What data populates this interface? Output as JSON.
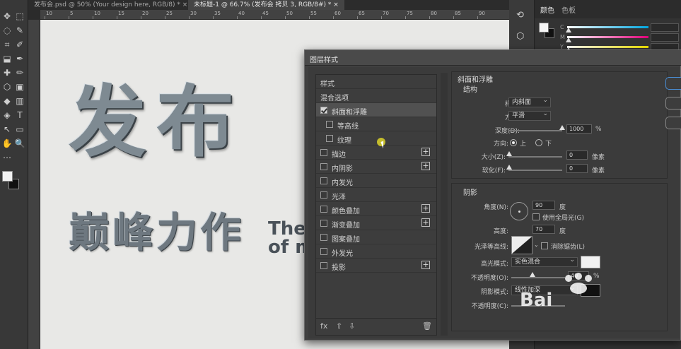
{
  "tabs": [
    {
      "label": "发布会.psd @ 50% (Your design here, RGB/8) *",
      "close": "×",
      "active": false
    },
    {
      "label": "未标题-1 @ 66.7% (发布会 拷贝 3, RGB/8#) *",
      "close": "×",
      "active": true
    }
  ],
  "ruler": {
    "top_ticks": [
      "10",
      "5",
      "10",
      "15",
      "20",
      "25",
      "30",
      "35",
      "40",
      "45",
      "50",
      "55",
      "60",
      "65",
      "70",
      "75",
      "80",
      "85",
      "90",
      "95"
    ]
  },
  "toolbar": {
    "tools": [
      {
        "a": "✥",
        "b": "⬚"
      },
      {
        "a": "◌",
        "b": "✎"
      },
      {
        "a": "⌗",
        "b": "✐"
      },
      {
        "a": "⬓",
        "b": "✒"
      },
      {
        "a": "✚",
        "b": "✏"
      },
      {
        "a": "⬡",
        "b": "▣"
      },
      {
        "a": "◆",
        "b": "▥"
      },
      {
        "a": "◈",
        "b": "T"
      },
      {
        "a": "↖",
        "b": "▭"
      },
      {
        "a": "✋",
        "b": "🔍"
      },
      {
        "a": "⋯",
        "b": ""
      }
    ]
  },
  "canvas": {
    "headline": "发布",
    "subline": "巅峰力作",
    "english_1": "The",
    "english_2": "of m"
  },
  "right_panel": {
    "tabs": [
      {
        "label": "颜色",
        "active": true
      },
      {
        "label": "色板",
        "active": false
      }
    ],
    "channels": [
      {
        "label": "C",
        "color": "#00a6e0",
        "value": ""
      },
      {
        "label": "M",
        "color": "#e0007a",
        "value": ""
      },
      {
        "label": "Y",
        "color": "#f2e600",
        "value": ""
      }
    ],
    "pct": "%"
  },
  "dialog": {
    "title": "图层样式",
    "styles_header": "样式",
    "blend_options": "混合选项",
    "items": [
      {
        "label": "斜面和浮雕",
        "checked": true,
        "plus": false,
        "indent": false,
        "selected": true
      },
      {
        "label": "等高线",
        "checked": false,
        "plus": false,
        "indent": true,
        "selected": false
      },
      {
        "label": "纹理",
        "checked": false,
        "plus": false,
        "indent": true,
        "selected": false
      },
      {
        "label": "描边",
        "checked": false,
        "plus": true,
        "indent": false,
        "selected": false
      },
      {
        "label": "内阴影",
        "checked": false,
        "plus": true,
        "indent": false,
        "selected": false
      },
      {
        "label": "内发光",
        "checked": false,
        "plus": false,
        "indent": false,
        "selected": false
      },
      {
        "label": "光泽",
        "checked": false,
        "plus": false,
        "indent": false,
        "selected": false
      },
      {
        "label": "颜色叠加",
        "checked": false,
        "plus": true,
        "indent": false,
        "selected": false
      },
      {
        "label": "渐变叠加",
        "checked": false,
        "plus": true,
        "indent": false,
        "selected": false
      },
      {
        "label": "图案叠加",
        "checked": false,
        "plus": false,
        "indent": false,
        "selected": false
      },
      {
        "label": "外发光",
        "checked": false,
        "plus": false,
        "indent": false,
        "selected": false
      },
      {
        "label": "投影",
        "checked": false,
        "plus": true,
        "indent": false,
        "selected": false
      }
    ],
    "footer": {
      "fx": "fx",
      "up": "⇧",
      "down": "⇩",
      "trash": "🗑"
    },
    "bevel": {
      "title": "斜面和浮雕",
      "structure_title": "结构",
      "style_label": "样式:",
      "style_value": "内斜面",
      "technique_label": "方法:",
      "technique_value": "平滑",
      "depth_label": "深度(D):",
      "depth_value": "1000",
      "depth_unit": "%",
      "depth_level": 1.0,
      "direction_label": "方向:",
      "dir_up": "上",
      "dir_down": "下",
      "size_label": "大小(Z):",
      "size_value": "0",
      "size_unit": "像素",
      "soften_label": "软化(F):",
      "soften_value": "0",
      "soften_unit": "像素"
    },
    "shading": {
      "title": "阴影",
      "angle_label": "角度(N):",
      "angle_value": "90",
      "angle_unit": "度",
      "global_light": "使用全局光(G)",
      "altitude_label": "高度:",
      "altitude_value": "70",
      "altitude_unit": "度",
      "gloss_label": "光泽等高线:",
      "antialias": "消除锯齿(L)",
      "highlight_label": "高光模式:",
      "highlight_value": "实色混合",
      "highlight_color": "#f2f2f2",
      "opacity_label": "不透明度(O):",
      "opacity_value": "40",
      "opacity_unit": "%",
      "opacity_level": 0.4,
      "shadow_label": "阴影模式:",
      "shadow_value": "线性加深",
      "opacity2_label": "不透明度(C):"
    }
  },
  "watermark": {
    "text": "Bai"
  }
}
